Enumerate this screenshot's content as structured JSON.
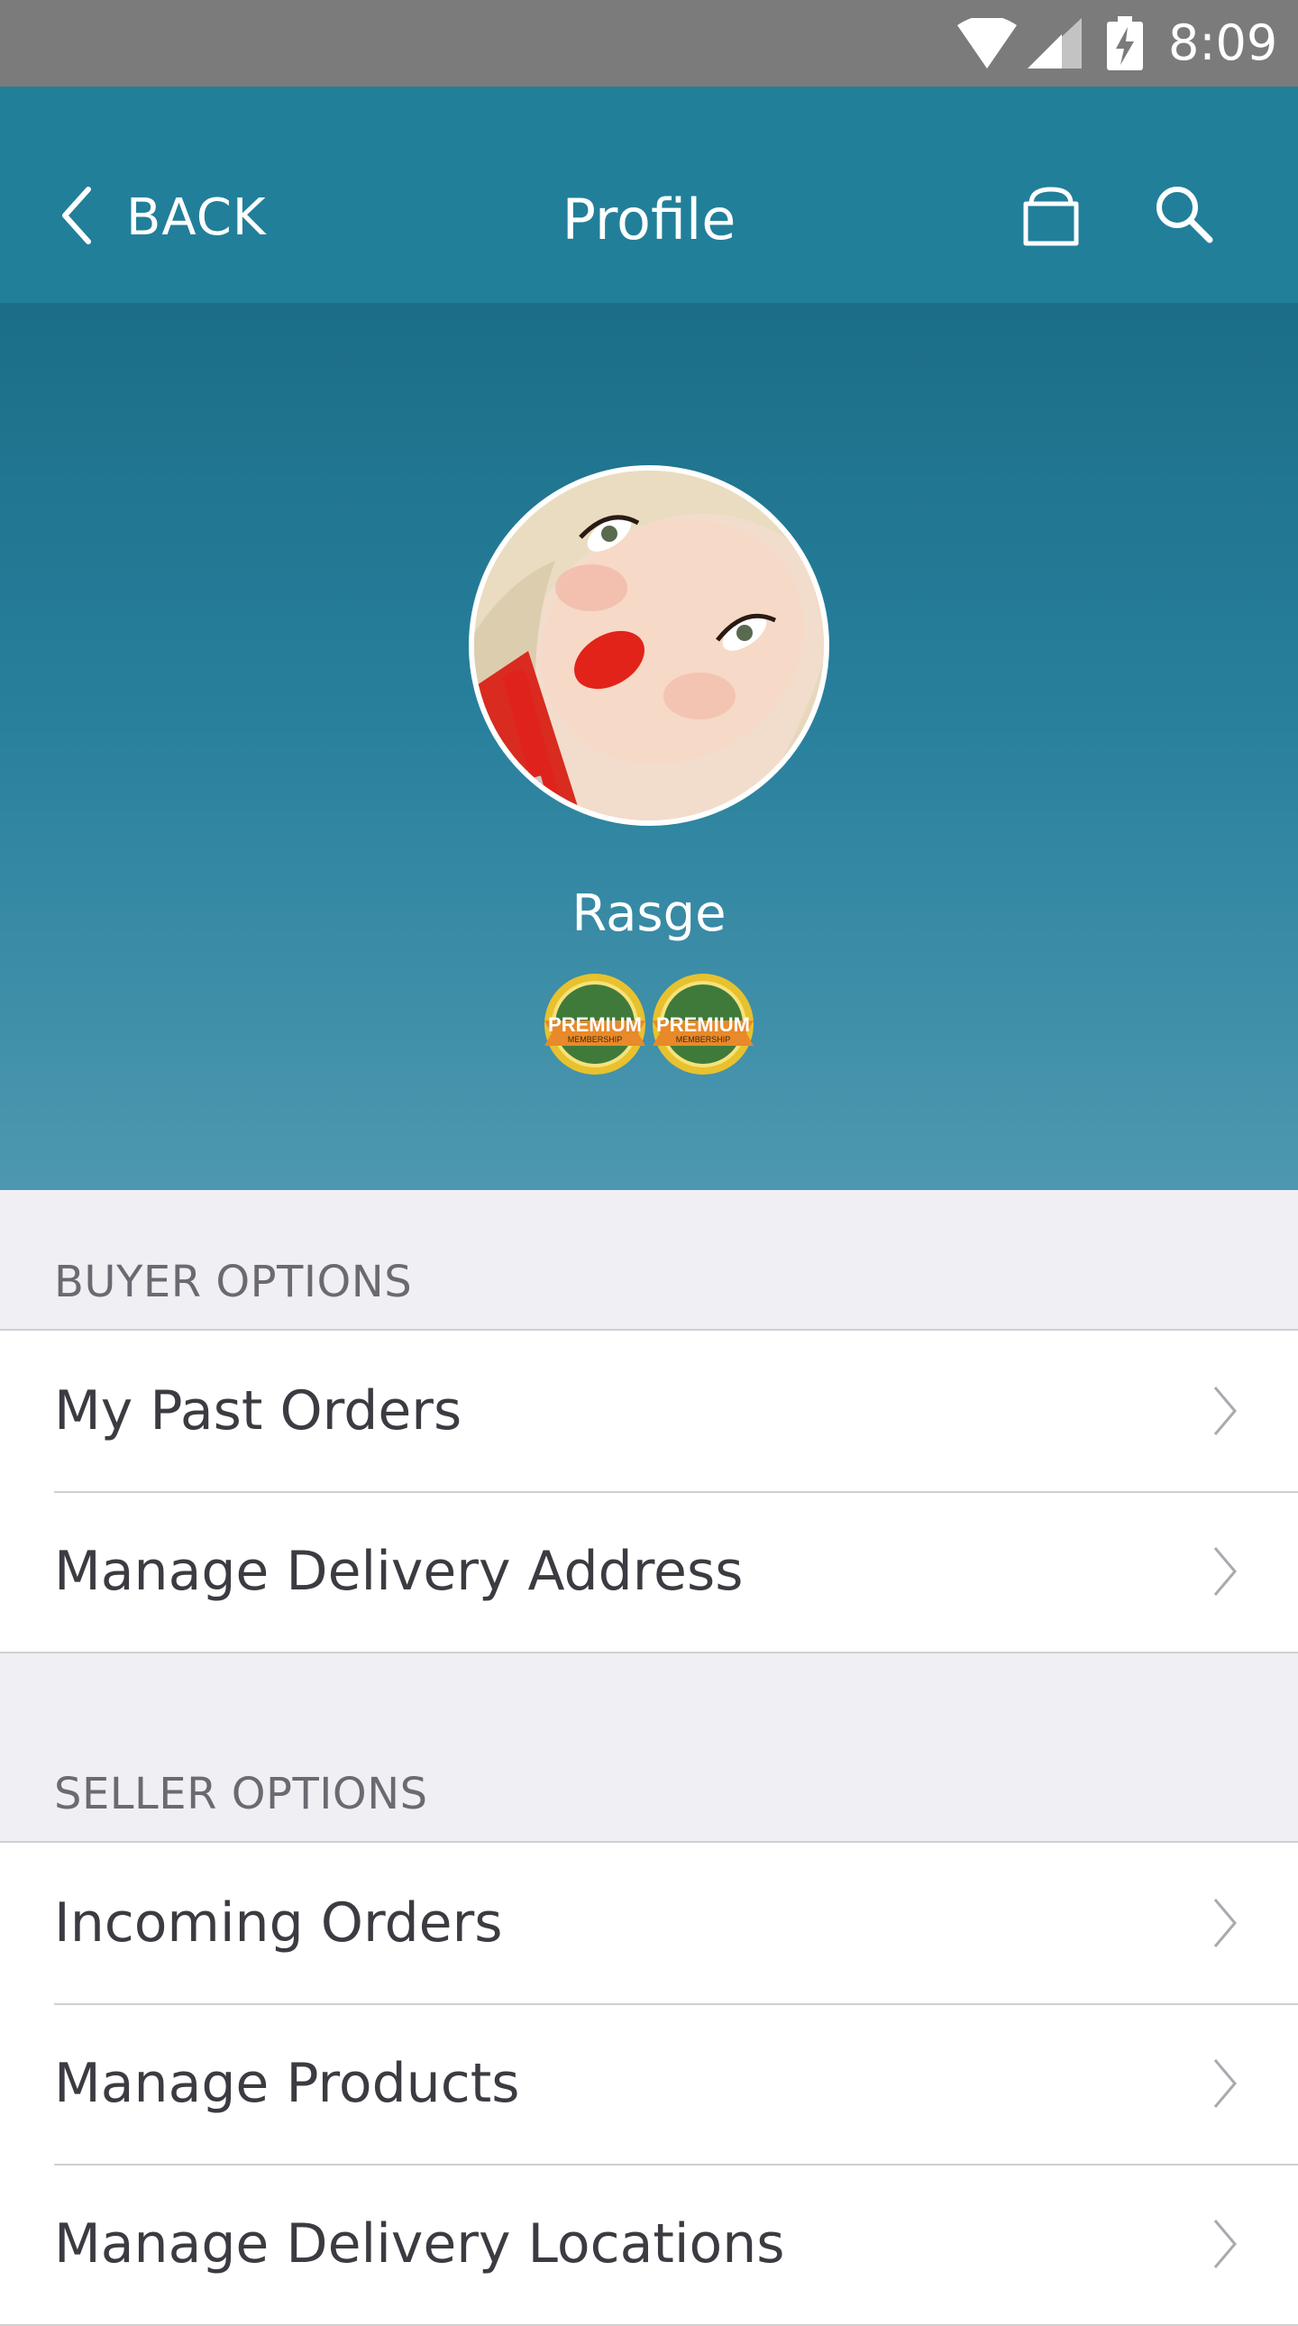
{
  "status_bar": {
    "time": "8:09"
  },
  "app_bar": {
    "back_label": "BACK",
    "title": "Profile",
    "icons": [
      "chevron-left-icon",
      "shopping-bag-icon",
      "search-icon"
    ]
  },
  "profile": {
    "username": "Rasge",
    "badges": [
      {
        "top_text": "PREMIUM",
        "bottom_text": "MEMBERSHIP"
      },
      {
        "top_text": "PREMIUM",
        "bottom_text": "MEMBERSHIP"
      }
    ]
  },
  "buyer_options": {
    "heading": "BUYER OPTIONS",
    "items": [
      {
        "label": "My Past Orders"
      },
      {
        "label": "Manage Delivery Address"
      }
    ]
  },
  "seller_options": {
    "heading": "SELLER OPTIONS",
    "items": [
      {
        "label": "Incoming Orders"
      },
      {
        "label": "Manage Products"
      },
      {
        "label": "Manage Delivery Locations"
      }
    ]
  },
  "colors": {
    "status_bar": "#7b7b7b",
    "app_bar": "#217f9a",
    "header_gradient_top": "#1c6e87",
    "header_gradient_bottom": "#4d98b0",
    "page_background": "#f0f0f4",
    "list_text": "#3b3b42",
    "section_text": "#6a6a72"
  }
}
